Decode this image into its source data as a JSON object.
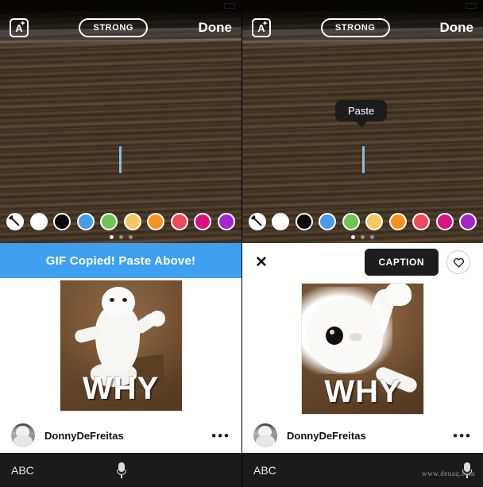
{
  "statusbar": {
    "time": "",
    "signal": "",
    "battery": ""
  },
  "panels": [
    {
      "id": "left",
      "editor": {
        "style_button_label": "A",
        "style_button_spark": "✦",
        "strength_label": "STRONG",
        "done_label": "Done",
        "tooltip_visible": false,
        "tooltip_label": ""
      },
      "palette": {
        "picker_name": "eyedropper",
        "colors": [
          "#ffffff",
          "#0b0b0b",
          "#4a9aea",
          "#71c454",
          "#f6c860",
          "#f7921e",
          "#ee4b5e",
          "#d9127e",
          "#a625cf"
        ],
        "pages": 3,
        "active_page": 1
      },
      "sheet": {
        "type": "banner",
        "banner_label": "GIF Copied! Paste Above!",
        "banner_color": "#3fa0ef",
        "meme_caption": "WHY",
        "meme_pose": "wide",
        "author": "DonnyDeFreitas",
        "menu_label": "•••"
      },
      "keyboard": {
        "abc_label": "ABC",
        "mic_name": "microphone-icon"
      }
    },
    {
      "id": "right",
      "editor": {
        "style_button_label": "A",
        "style_button_spark": "✦",
        "strength_label": "STRONG",
        "done_label": "Done",
        "tooltip_visible": true,
        "tooltip_label": "Paste"
      },
      "palette": {
        "picker_name": "eyedropper",
        "colors": [
          "#ffffff",
          "#0b0b0b",
          "#4a9aea",
          "#71c454",
          "#f6c860",
          "#f7921e",
          "#ee4b5e",
          "#d9127e",
          "#a625cf"
        ],
        "pages": 3,
        "active_page": 1
      },
      "sheet": {
        "type": "actions",
        "close_label": "✕",
        "caption_label": "CAPTION",
        "favorite_name": "heart-icon",
        "meme_caption": "WHY",
        "meme_pose": "close",
        "author": "DonnyDeFreitas",
        "menu_label": "•••"
      },
      "keyboard": {
        "abc_label": "ABC",
        "mic_name": "microphone-icon"
      }
    }
  ],
  "watermark": "www.deuaq.com"
}
